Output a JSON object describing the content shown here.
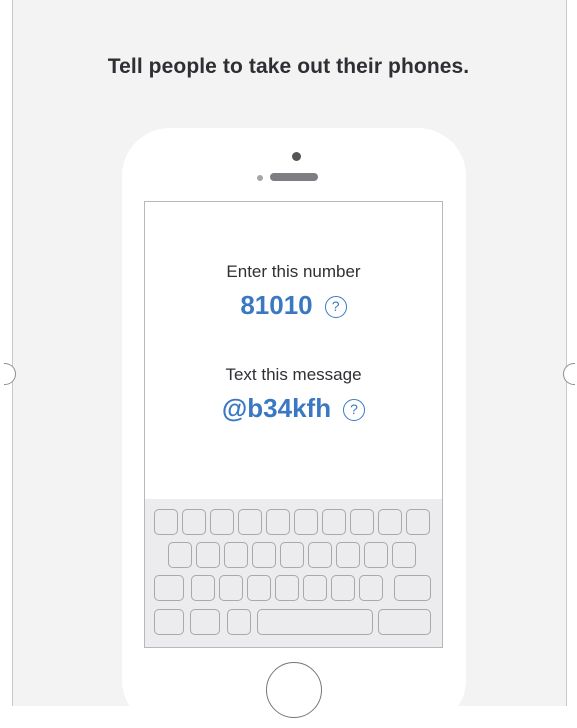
{
  "heading": "Tell people to take out their phones.",
  "phone": {
    "number_label": "Enter this number",
    "number_value": "81010",
    "message_label": "Text this message",
    "message_value": "@b34kfh",
    "help_glyph": "?"
  },
  "icons": {
    "help": "help-circle-icon",
    "resize": "panel-resize-handle"
  },
  "colors": {
    "accent": "#3a78c2",
    "panel_background": "#f3f3f4",
    "text": "#2e2e33"
  }
}
